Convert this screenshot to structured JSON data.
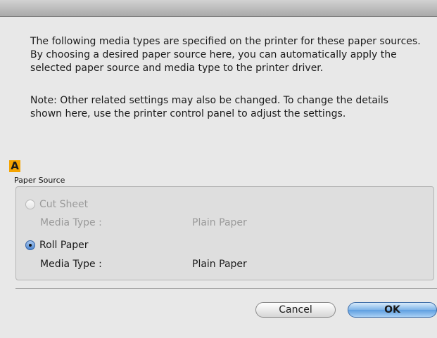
{
  "intro_text": "The following media types are specified on the printer for these paper sources. By choosing a desired paper source here, you can automatically apply the selected paper source and media type to the printer driver.",
  "note_text": "Note: Other related settings may also be changed. To change the details shown here, use the printer control panel to adjust the settings.",
  "marker_label": "A",
  "paper_source": {
    "title": "Paper Source",
    "options": [
      {
        "label": "Cut Sheet",
        "selected": false,
        "enabled": false,
        "media_type_label": "Media Type :",
        "media_type_value": "Plain Paper"
      },
      {
        "label": "Roll Paper",
        "selected": true,
        "enabled": true,
        "media_type_label": "Media Type :",
        "media_type_value": "Plain Paper"
      }
    ]
  },
  "buttons": {
    "cancel": "Cancel",
    "ok": "OK"
  }
}
